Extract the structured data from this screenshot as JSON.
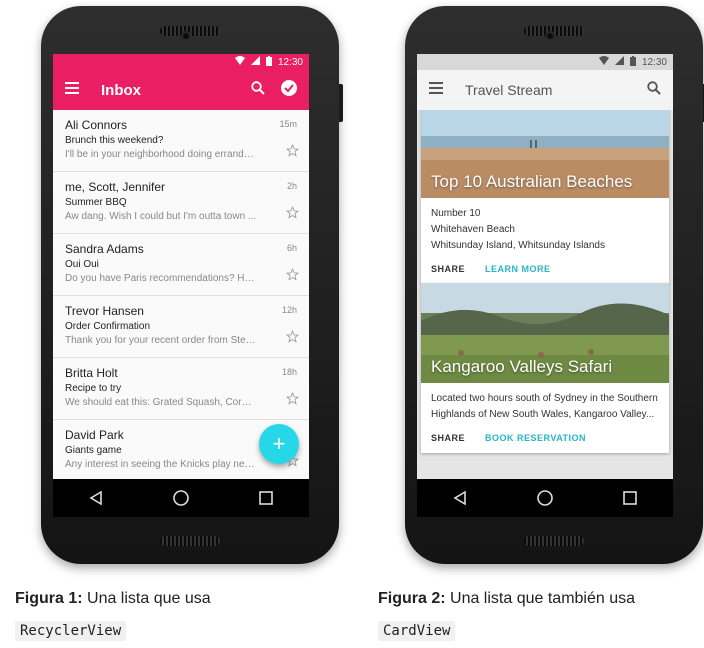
{
  "left_phone": {
    "status_time": "12:30",
    "toolbar": {
      "title": "Inbox"
    },
    "emails": [
      {
        "sender": "Ali Connors",
        "subject": "Brunch this weekend?",
        "preview": "I'll be in your neighborhood doing errands ...",
        "time": "15m"
      },
      {
        "sender": "me, Scott, Jennifer",
        "subject": "Summer BBQ",
        "preview": "Aw dang. Wish I could but I'm outta town ...",
        "time": "2h"
      },
      {
        "sender": "Sandra Adams",
        "subject": "Oui Oui",
        "preview": "Do you have Paris recommendations? Hav...",
        "time": "6h"
      },
      {
        "sender": "Trevor Hansen",
        "subject": "Order Confirmation",
        "preview": "Thank you for your recent order from Stev...",
        "time": "12h"
      },
      {
        "sender": "Britta Holt",
        "subject": "Recipe to try",
        "preview": "We should eat this: Grated Squash, Corn, ...",
        "time": "18h"
      },
      {
        "sender": "David Park",
        "subject": "Giants game",
        "preview": "Any interest in seeing the Knicks play next ...",
        "time": ""
      }
    ],
    "fab_label": "+",
    "accent_color": "#e91e63",
    "fab_color": "#26d7e8"
  },
  "right_phone": {
    "status_time": "12:30",
    "toolbar": {
      "title": "Travel Stream"
    },
    "cards": [
      {
        "title": "Top 10 Australian Beaches",
        "lines": [
          "Number 10",
          "Whitehaven Beach",
          "Whitsunday Island, Whitsunday Islands"
        ],
        "share": "SHARE",
        "action": "LEARN MORE"
      },
      {
        "title": "Kangaroo Valleys Safari",
        "lines": [
          "Located two hours south of Sydney in the Southern",
          "Highlands of New South Wales, Kangaroo Valley..."
        ],
        "share": "SHARE",
        "action": "BOOK RESERVATION"
      }
    ],
    "accent_color": "#26b5c7"
  },
  "captions": {
    "fig1_label": "Figura 1:",
    "fig1_text": " Una lista que usa",
    "fig1_code": "RecyclerView",
    "fig2_label": "Figura 2:",
    "fig2_text": " Una lista que también usa",
    "fig2_code": "CardView"
  }
}
